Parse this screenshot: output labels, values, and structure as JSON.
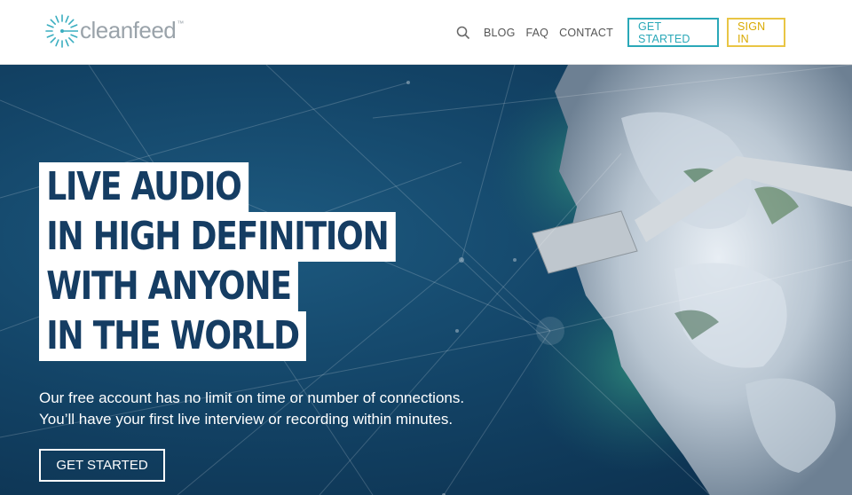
{
  "logo": {
    "text": "cleanfeed",
    "tm": "™"
  },
  "nav": {
    "search_icon": "search-icon",
    "links": [
      "BLOG",
      "FAQ",
      "CONTACT"
    ],
    "get_started": "GET STARTED",
    "sign_in": "SIGN IN"
  },
  "hero": {
    "headline": [
      "LIVE AUDIO",
      "IN HIGH DEFINITION",
      "WITH ANYONE",
      "IN THE WORLD"
    ],
    "sub": [
      "Our free account has no limit on time or number of connections.",
      "You’ll have your first live interview or recording within minutes."
    ],
    "cta": "GET STARTED"
  },
  "colors": {
    "accent_teal": "#2aa8b8",
    "accent_yellow": "#e9c544",
    "headline_navy": "#153d63",
    "ocean": "#134467"
  }
}
